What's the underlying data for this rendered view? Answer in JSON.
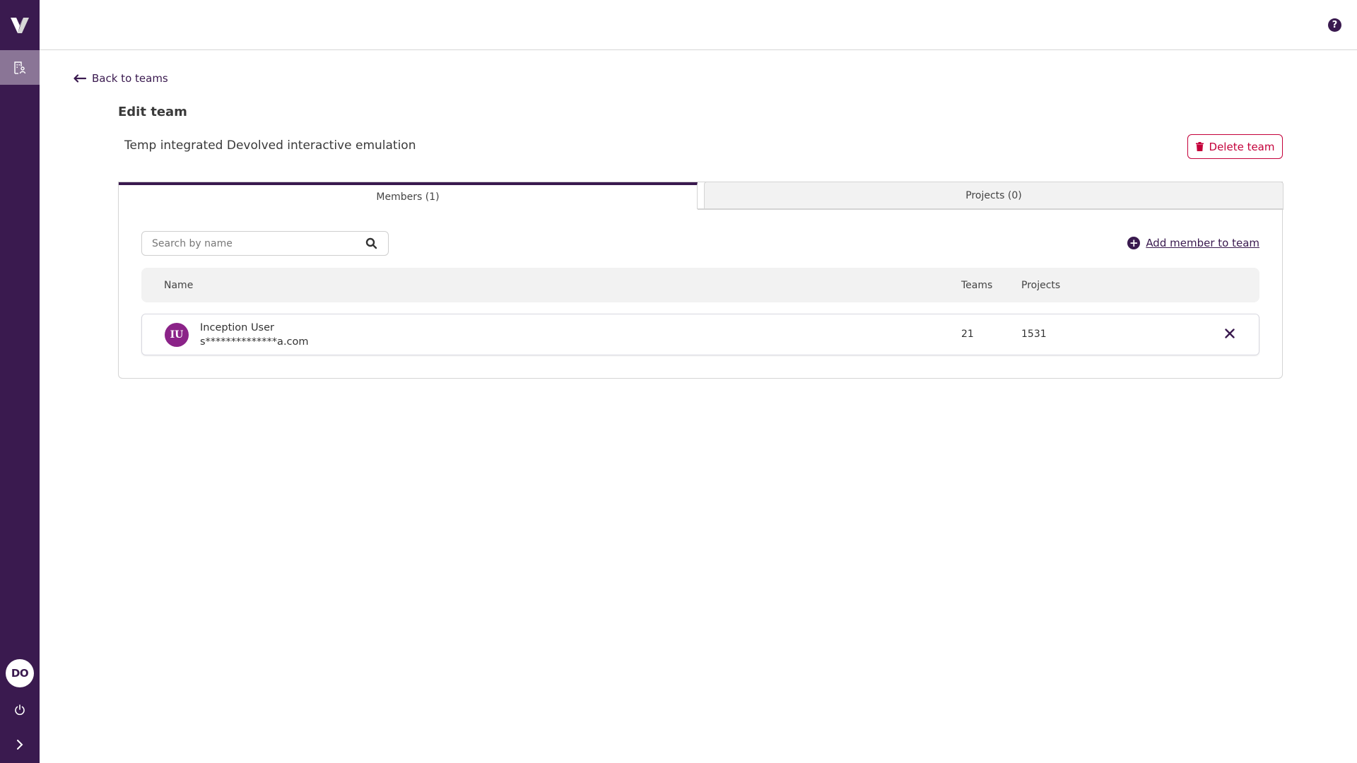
{
  "app": {
    "logo_icon": "v-logo-icon",
    "brand_color": "#3a1a4f",
    "danger_color": "#c4003a"
  },
  "sidebar": {
    "nav_items": [
      {
        "icon": "building-user-icon",
        "label": "Teams",
        "active": true
      }
    ],
    "user_initials": "DO",
    "power_icon": "power-icon",
    "expand_icon": "chevron-right-icon"
  },
  "topbar": {
    "help_label": "?"
  },
  "page": {
    "back_label": "Back to teams",
    "title": "Edit team",
    "team_name": "Temp integrated Devolved interactive emulation",
    "delete_label": "Delete team"
  },
  "tabs": [
    {
      "label": "Members (1)",
      "active": true
    },
    {
      "label": "Projects (0)",
      "active": false
    }
  ],
  "members": {
    "search_placeholder": "Search by name",
    "search_value": "",
    "add_member_label": "Add member to team",
    "columns": {
      "name": "Name",
      "teams": "Teams",
      "projects": "Projects"
    },
    "rows": [
      {
        "initials": "IU",
        "name": "Inception User",
        "email": "s**************a.com",
        "teams": "21",
        "projects": "1531",
        "avatar_color": "#8b2388"
      }
    ]
  }
}
